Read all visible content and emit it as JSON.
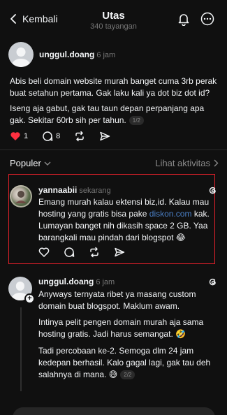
{
  "header": {
    "back_label": "Kembali",
    "title": "Utas",
    "subtitle": "340 tayangan"
  },
  "main_post": {
    "username": "unggul.doang",
    "time": "6 jam",
    "para1": "Abis beli domain website murah banget cuma 3rb perak buat setahun pertama. Gak laku kali ya dot biz dot id?",
    "para2": "Iseng aja gabut, gak tau taun depan perpanjang apa gak. Sekitar 60rb sih per tahun.",
    "page_badge": "1/2",
    "like_count": "1",
    "reply_count": "8"
  },
  "section": {
    "populer_label": "Populer",
    "activity_label": "Lihat aktivitas"
  },
  "reply1": {
    "username": "yannaabii",
    "time": "sekarang",
    "text_before_link": "Emang murah kalau ektensi biz,id. Kalau mau hosting yang gratis bisa pake",
    "link": "diskon.com",
    "text_after_link": "kak. Lumayan banget nih dikasih space 2 GB. Yaa barangkali mau pindah dari blogspot 😂"
  },
  "reply2": {
    "username": "unggul.doang",
    "time": "6 jam",
    "para1": "Anyways ternyata ribet ya masang custom domain buat blogspot. Maklum awam.",
    "para2": "Intinya pelit pengen domain murah aja sama hosting gratis. Jadi harus semangat. 🤣",
    "para3": "Tadi percobaan ke-2. Semoga dlm 24 jam kedepan berhasil. Kalo gagal lagi, gak tau deh salahnya di mana. 😅",
    "page_badge": "2/2"
  },
  "icons": {
    "back": "chevron-left-icon",
    "bell": "bell-icon",
    "more": "more-icon",
    "like": "heart-icon",
    "reply": "comment-icon",
    "repost": "repost-icon",
    "share": "send-icon",
    "threads": "threads-logo-icon"
  },
  "colors": {
    "background": "#101010",
    "text": "#f3f5f7",
    "muted": "#777777",
    "like_red": "#ff3040",
    "link_blue": "#4a7fc5",
    "highlight_red": "#e0202a"
  }
}
